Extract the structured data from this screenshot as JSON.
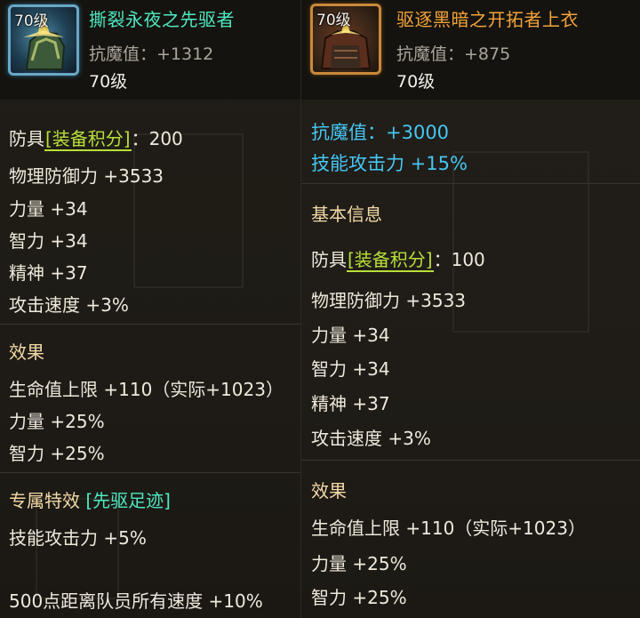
{
  "left": {
    "item": {
      "level_badge": "70级",
      "name": "撕裂永夜之先驱者",
      "resist_label": "抗魔值：+1312",
      "level": "70级"
    },
    "base": {
      "type": "防具",
      "score_tag": "[装备积分]",
      "score_value": "：200",
      "stats": [
        "物理防御力 +3533",
        "力量 +34",
        "智力 +34",
        "精神 +37",
        "攻击速度 +3%"
      ]
    },
    "effect": {
      "heading": "效果",
      "lines": [
        "生命值上限 +110（实际+1023）",
        "力量 +25%",
        "智力 +25%"
      ]
    },
    "special": {
      "label": "专属特效",
      "tag": "[先驱足迹]",
      "lines": [
        "技能攻击力 +5%",
        "500点距离队员所有速度 +10%"
      ]
    }
  },
  "right": {
    "item": {
      "level_badge": "70级",
      "name": "驱逐黑暗之开拓者上衣",
      "resist_label": "抗魔值：+875",
      "level": "70级"
    },
    "bonus": [
      "抗魔值：+3000",
      "技能攻击力 +15%"
    ],
    "basic_heading": "基本信息",
    "base": {
      "type": "防具",
      "score_tag": "[装备积分]",
      "score_value": "：100",
      "stats": [
        "物理防御力 +3533",
        "力量 +34",
        "智力 +34",
        "精神 +37",
        "攻击速度 +3%"
      ]
    },
    "effect": {
      "heading": "效果",
      "lines": [
        "生命值上限 +110（实际+1023）",
        "力量 +25%",
        "智力 +25%"
      ]
    }
  },
  "colors": {
    "name_green": "#4ee8c0",
    "name_orange": "#f2a33a",
    "score_tag": "#b8df3a",
    "bonus_blue": "#45c6f2",
    "heading": "#f2d9a6"
  }
}
